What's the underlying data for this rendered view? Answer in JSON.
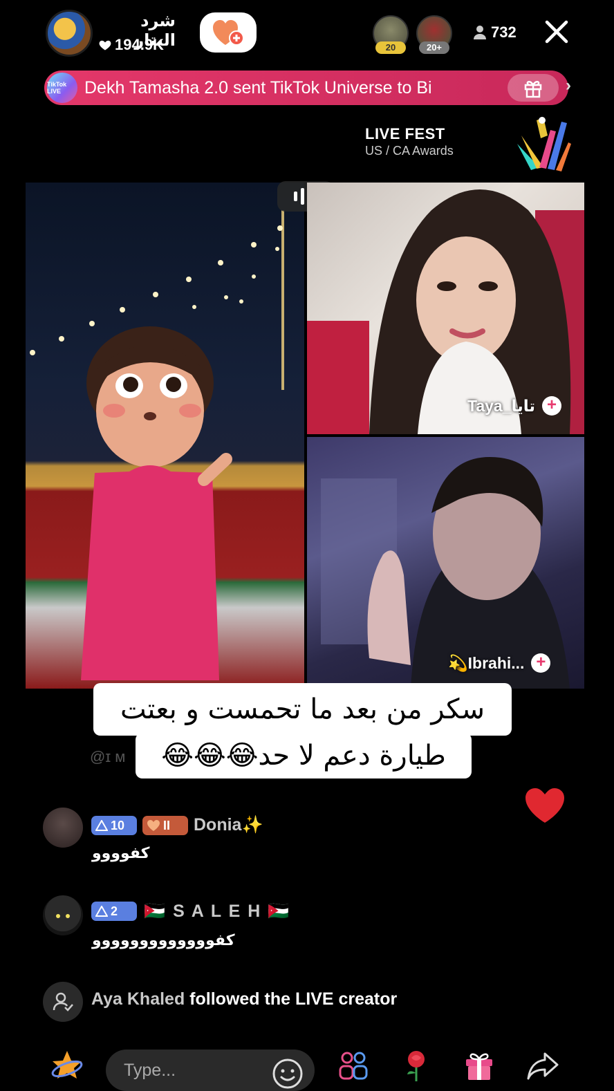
{
  "header": {
    "host_name": "شرد البتار",
    "likes": "194.9K",
    "viewers": [
      {
        "rank": "20",
        "rank_color": "#e8c43a"
      },
      {
        "rank": "20+",
        "rank_color": "#888888"
      }
    ],
    "viewer_count": "732",
    "icons": {
      "likes": "heart-icon",
      "follow": "follow-heart-plus-icon",
      "viewers": "person-icon",
      "close": "close-icon"
    }
  },
  "banner": {
    "logo_text": "TikTok LIVE",
    "text": "Dekh Tamasha 2.0 sent TikTok Universe to Bi",
    "icon": "gift-icon",
    "arrow": "›"
  },
  "live_fest": {
    "title": "LIVE FEST",
    "subtitle": "US / CA Awards"
  },
  "guests": [
    {
      "name": "Taya_تايا",
      "action": "+"
    },
    {
      "name": "💫Ibrahi...",
      "action": "+"
    }
  ],
  "caption": {
    "line1": "سكر من بعد ما تحمست و بعتت",
    "line2": "طيارة دعم لا حد😂😂😂"
  },
  "ghost_comment": "@ɪ ᴍ",
  "comments": [
    {
      "level": "10",
      "fan_badge": "II",
      "username": "Donia✨",
      "text": "كفوووو"
    },
    {
      "level": "2",
      "username": "🇯🇴 S A L E H 🇯🇴",
      "text": "كفووووووووووووو"
    }
  ],
  "event": {
    "user": "Aya Khaled",
    "action": " followed the LIVE creator"
  },
  "bottom_bar": {
    "input_placeholder": "Type...",
    "icons": [
      "star-icon",
      "emoji-icon",
      "multi-guest-icon",
      "rose-gift-icon",
      "gift-icon",
      "share-icon"
    ]
  },
  "colors": {
    "accent_pink": "#e4386a",
    "level_blue": "#5a7fe0",
    "fan_orange": "#c45a3a"
  }
}
